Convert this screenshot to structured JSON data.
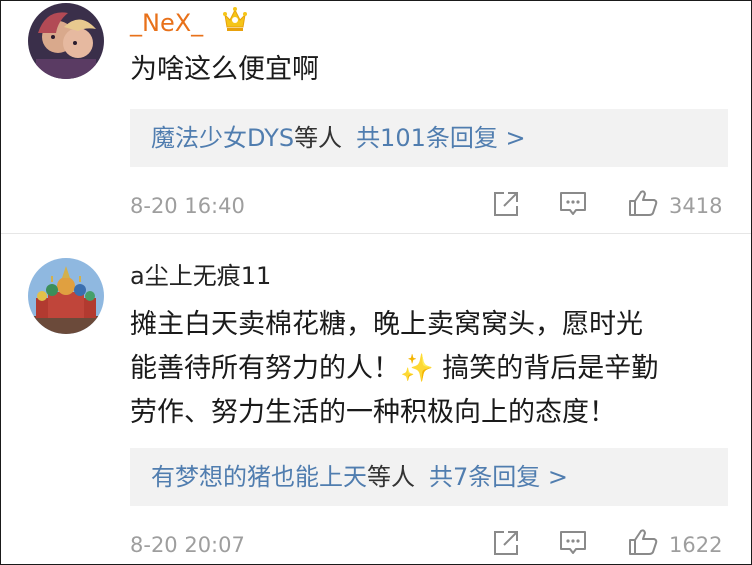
{
  "comments": [
    {
      "username": "_NeX_",
      "badge_icon": "crown-icon",
      "text_lines": [
        "为啥这么便宜啊"
      ],
      "reply_summary": {
        "names": "魔法少女DYS",
        "suffix": "等人",
        "count": "共101条回复 >"
      },
      "timestamp": "8-20 16:40",
      "likes": "3418"
    },
    {
      "username": "a尘上无痕11",
      "text_lines": [
        "摊主白天卖棉花糖，晚上卖窝窝头，愿时光",
        "能善待所有努力的人！✨ 搞笑的背后是辛勤",
        "劳作、努力生活的一种积极向上的态度！"
      ],
      "reply_summary": {
        "names": "有梦想的猪也能上天",
        "suffix": "等人",
        "count": "共7条回复 >"
      },
      "timestamp": "8-20 20:07",
      "likes": "1622"
    }
  ],
  "icons": {
    "share": "share-icon",
    "comment": "comment-icon",
    "like": "thumbs-up-icon"
  },
  "colors": {
    "vip_name": "#e8711a",
    "link": "#507daf",
    "reply_bg": "#f2f2f2",
    "meta_gray": "#9e9e9e",
    "icon_gray": "#8a8a8a"
  }
}
